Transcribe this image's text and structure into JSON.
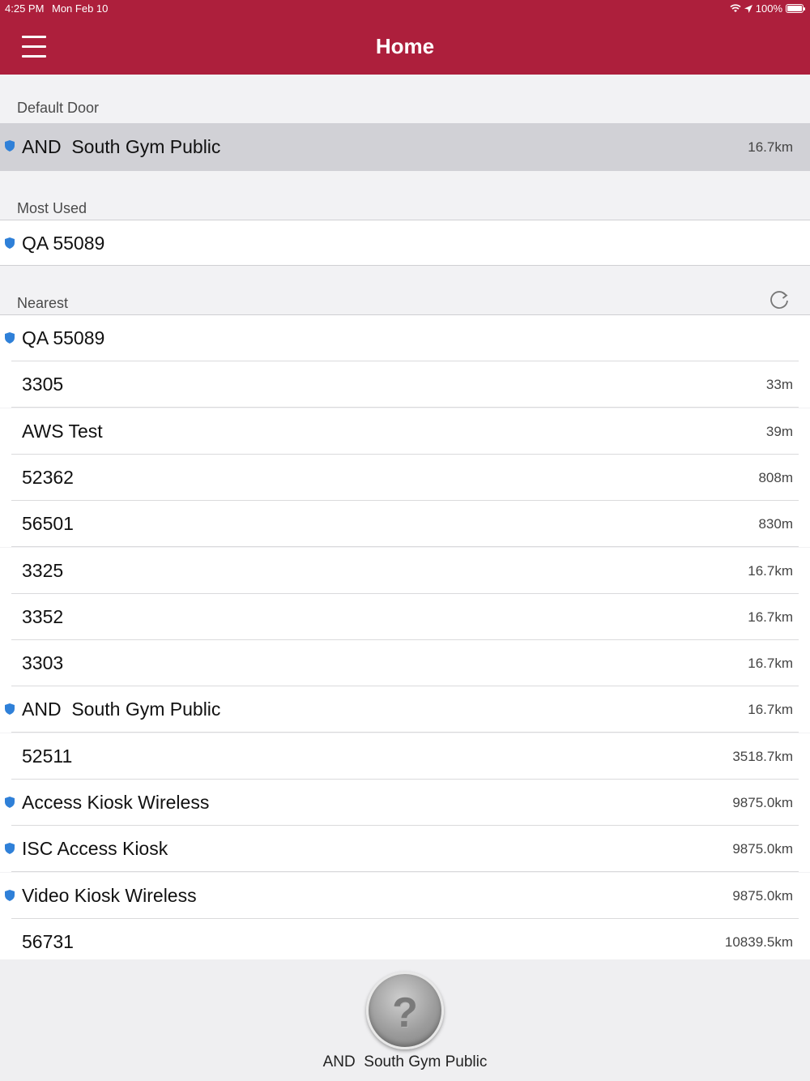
{
  "status_bar": {
    "time": "4:25 PM",
    "date": "Mon Feb 10",
    "battery": "100%"
  },
  "header": {
    "title": "Home"
  },
  "default_door": {
    "label": "Default Door",
    "item": {
      "name": "AND  South Gym Public",
      "distance": "16.7km",
      "secure": true
    }
  },
  "most_used": {
    "label": "Most Used",
    "items": [
      {
        "name": "QA 55089",
        "distance": "",
        "secure": true
      }
    ]
  },
  "nearest": {
    "label": "Nearest",
    "items": [
      {
        "name": "QA 55089",
        "distance": "",
        "secure": true
      },
      {
        "name": "3305",
        "distance": "33m",
        "secure": false
      },
      {
        "name": "AWS Test",
        "distance": "39m",
        "secure": false
      },
      {
        "name": "52362",
        "distance": "808m",
        "secure": false
      },
      {
        "name": "56501",
        "distance": "830m",
        "secure": false
      },
      {
        "name": "3325",
        "distance": "16.7km",
        "secure": false
      },
      {
        "name": "3352",
        "distance": "16.7km",
        "secure": false
      },
      {
        "name": "3303",
        "distance": "16.7km",
        "secure": false
      },
      {
        "name": "AND  South Gym Public",
        "distance": "16.7km",
        "secure": true
      },
      {
        "name": "52511",
        "distance": "3518.7km",
        "secure": false
      },
      {
        "name": "Access Kiosk Wireless",
        "distance": "9875.0km",
        "secure": true
      },
      {
        "name": "ISC Access Kiosk",
        "distance": "9875.0km",
        "secure": true
      },
      {
        "name": "Video Kiosk Wireless",
        "distance": "9875.0km",
        "secure": true
      },
      {
        "name": "56731",
        "distance": "10839.5km",
        "secure": false
      }
    ]
  },
  "footer": {
    "door_label": "AND  South Gym Public",
    "button_glyph": "?"
  },
  "colors": {
    "header": "#ad1f3c",
    "shield": "#2f80d8"
  },
  "icons": {
    "menu": "hamburger-menu-icon",
    "refresh": "refresh-icon",
    "secure": "shield-icon",
    "door_status": "unknown-status-icon"
  }
}
